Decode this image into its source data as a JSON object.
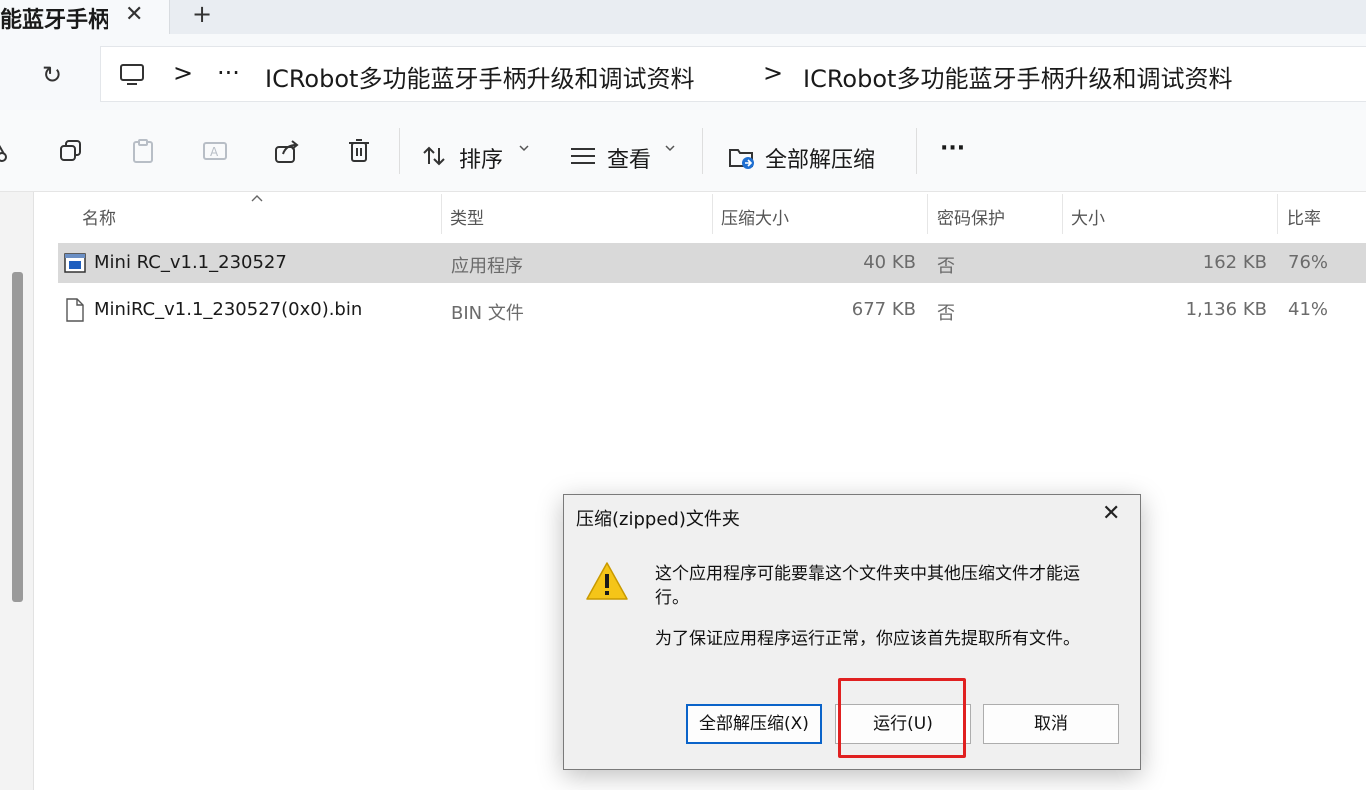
{
  "tab": {
    "title": "能蓝牙手柄升级和调试资料",
    "close": "✕",
    "new_tab": "+"
  },
  "address": {
    "refresh": "↻",
    "ellipsis": "···",
    "separator": ">",
    "crumbs": [
      "ICRobot多功能蓝牙手柄升级和调试资料",
      "ICRobot多功能蓝牙手柄升级和调试资料"
    ]
  },
  "toolbar": {
    "sort_label": "排序",
    "view_label": "查看",
    "extract_all_label": "全部解压缩",
    "more_label": "···"
  },
  "columns": [
    "名称",
    "类型",
    "压缩大小",
    "密码保护",
    "大小",
    "比率"
  ],
  "files": [
    {
      "name": "Mini RC_v1.1_230527",
      "type": "应用程序",
      "compressed": "40 KB",
      "protected": "否",
      "size": "162 KB",
      "ratio": "76%"
    },
    {
      "name": "MiniRC_v1.1_230527(0x0).bin",
      "type": "BIN 文件",
      "compressed": "677 KB",
      "protected": "否",
      "size": "1,136 KB",
      "ratio": "41%"
    }
  ],
  "dialog": {
    "title": "压缩(zipped)文件夹",
    "close": "✕",
    "message_line1": "这个应用程序可能要靠这个文件夹中其他压缩文件才能运",
    "message_line2": "行。",
    "message_line3": "为了保证应用程序运行正常，你应该首先提取所有文件。",
    "extract_button": "全部解压缩(X)",
    "run_button": "运行(U)",
    "cancel_button": "取消"
  },
  "colors": {
    "warning": "#f5c518",
    "highlight": "#e02020",
    "selected_row": "#d9d9d9",
    "focus_border": "#0a63c9"
  }
}
